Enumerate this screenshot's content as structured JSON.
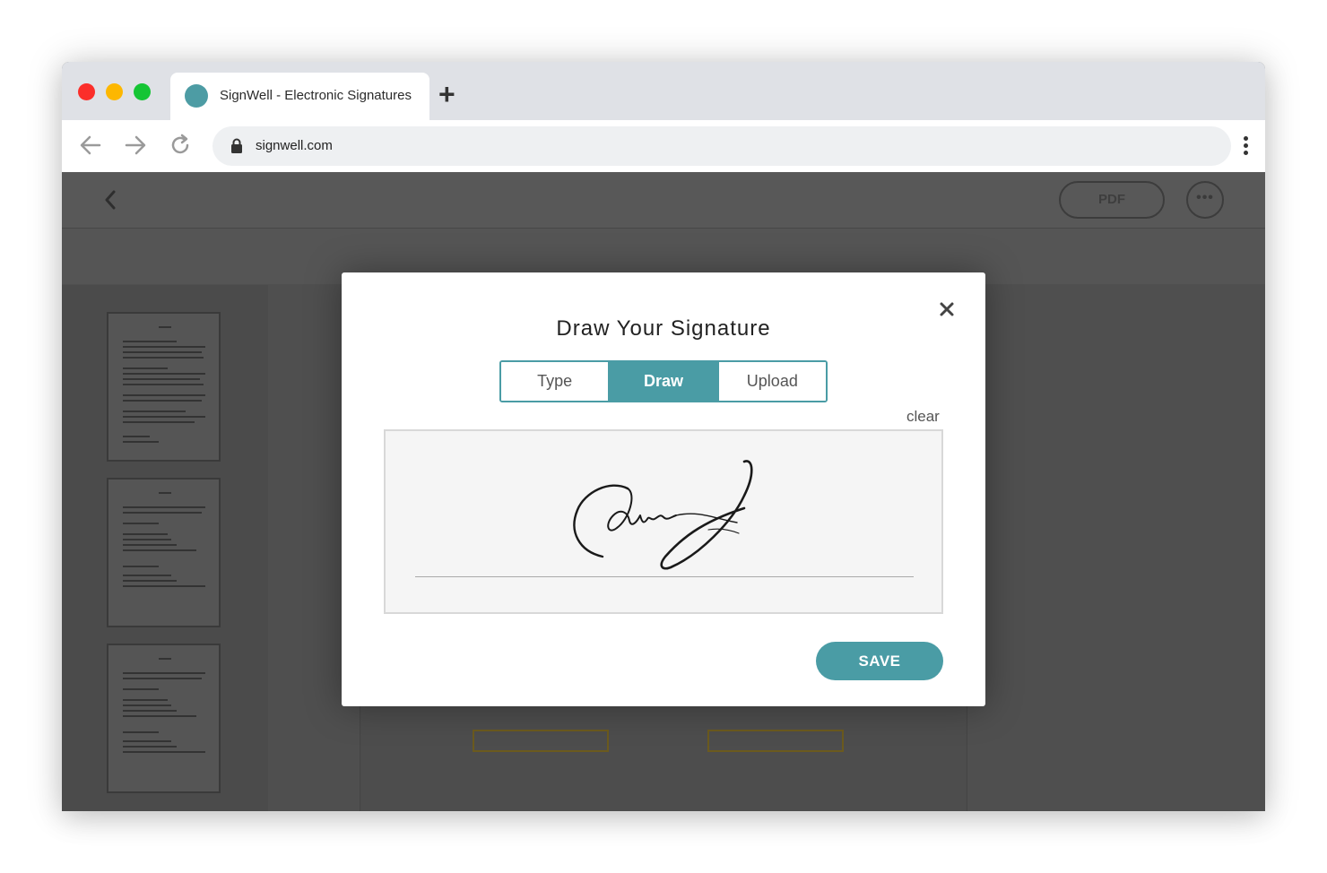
{
  "browser": {
    "tab_title": "SignWell - Electronic Signatures",
    "new_tab_icon": "plus-icon",
    "url": "signwell.com",
    "colors": {
      "close": "#fb2e2a",
      "minimize": "#fdb700",
      "maximize": "#15c534",
      "favicon": "#4d9ca4"
    }
  },
  "app": {
    "header": {
      "pdf_label": "PDF",
      "more_label": "•••"
    }
  },
  "modal": {
    "title": "Draw Your Signature",
    "tabs": [
      {
        "label": "Type",
        "active": false
      },
      {
        "label": "Draw",
        "active": true
      },
      {
        "label": "Upload",
        "active": false
      }
    ],
    "clear_label": "clear",
    "save_label": "SAVE",
    "accent": "#4a9ca5"
  }
}
